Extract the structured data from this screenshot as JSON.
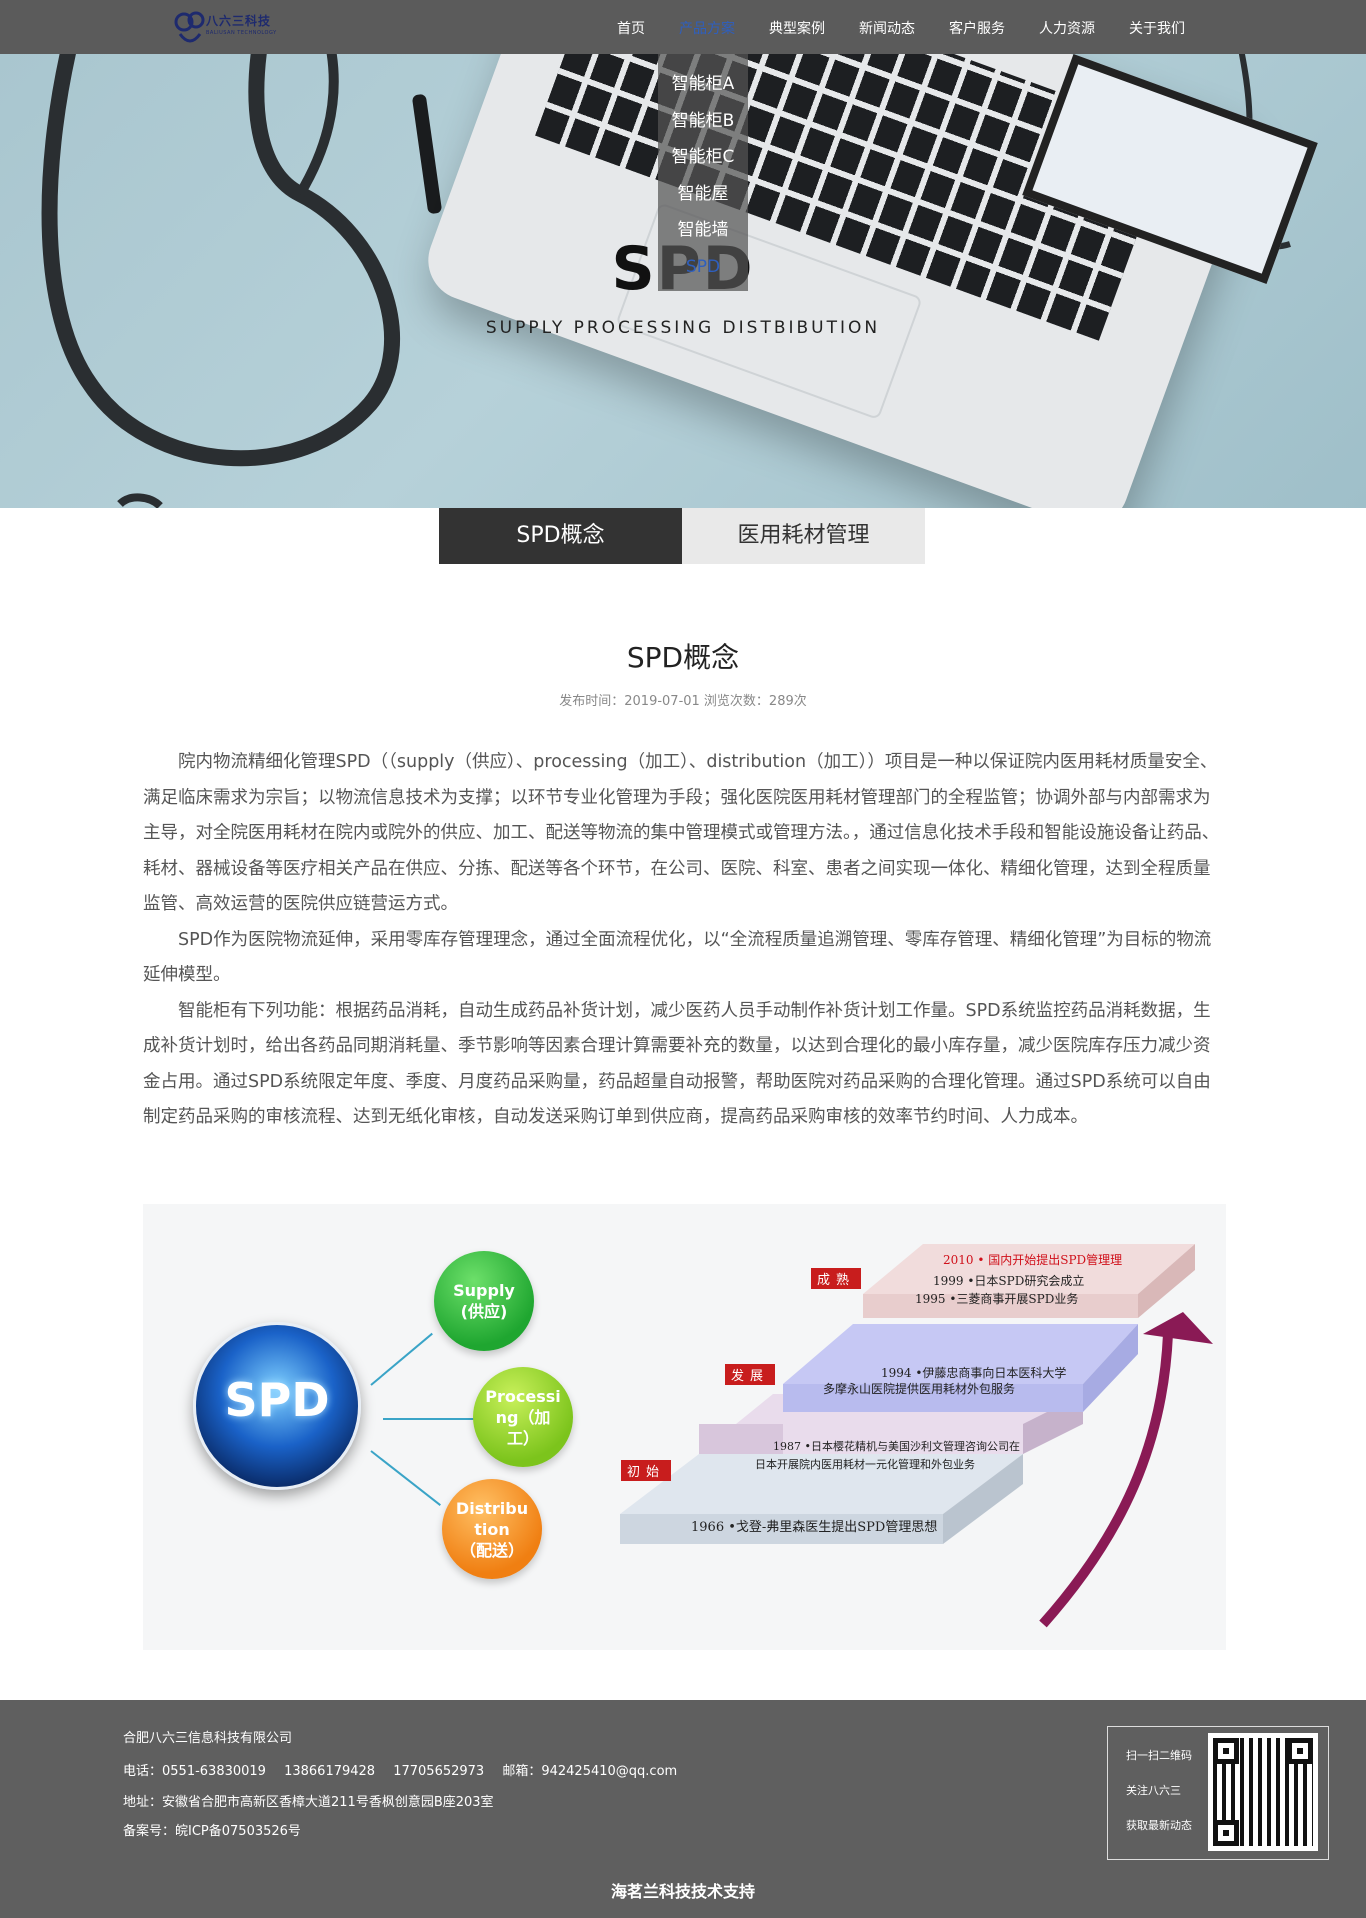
{
  "header": {
    "logo_text": "八六三科技",
    "logo_sub": "BALIUSAN TECHNOLOGY",
    "nav": [
      {
        "label": "首页",
        "active": false
      },
      {
        "label": "产品方案",
        "active": true
      },
      {
        "label": "典型案例",
        "active": false
      },
      {
        "label": "新闻动态",
        "active": false
      },
      {
        "label": "客户服务",
        "active": false
      },
      {
        "label": "人力资源",
        "active": false
      },
      {
        "label": "关于我们",
        "active": false
      }
    ],
    "dropdown": [
      {
        "label": "智能柜A",
        "active": false
      },
      {
        "label": "智能柜B",
        "active": false
      },
      {
        "label": "智能柜C",
        "active": false
      },
      {
        "label": "智能屋",
        "active": false
      },
      {
        "label": "智能墙",
        "active": false
      },
      {
        "label": "SPD",
        "active": true
      }
    ]
  },
  "hero": {
    "title": "SPD",
    "subtitle": "SUPPLY PROCESSING DISTBIBUTION"
  },
  "tabs": [
    {
      "label": "SPD概念",
      "active": true
    },
    {
      "label": "医用耗材管理",
      "active": false
    }
  ],
  "article": {
    "title": "SPD概念",
    "meta": "发布时间：2019-07-01  浏览次数：289次",
    "paragraphs": [
      "院内物流精细化管理SPD（（supply（供应）、processing（加工）、distribution（加工））项目是一种以保证院内医用耗材质量安全、满足临床需求为宗旨；以物流信息技术为支撑；以环节专业化管理为手段；强化医院医用耗材管理部门的全程监管；协调外部与内部需求为主导，对全院医用耗材在院内或院外的供应、加工、配送等物流的集中管理模式或管理方法。，通过信息化技术手段和智能设施设备让药品、耗材、器械设备等医疗相关产品在供应、分拣、配送等各个环节，在公司、医院、科室、患者之间实现一体化、精细化管理，达到全程质量监管、高效运营的医院供应链营运方式。",
      " SPD作为医院物流延伸，采用零库存管理理念，通过全面流程优化，以“全流程质量追溯管理、零库存管理、精细化管理”为目标的物流延伸模型。",
      "智能柜有下列功能：根据药品消耗，自动生成药品补货计划，减少医药人员手动制作补货计划工作量。SPD系统监控药品消耗数据，生成补货计划时，给出各药品同期消耗量、季节影响等因素合理计算需要补充的数量，以达到合理化的最小库存量，减少医院库存压力减少资金占用。通过SPD系统限定年度、季度、月度药品采购量，药品超量自动报警，帮助医院对药品采购的合理化管理。通过SPD系统可以自由制定药品采购的审核流程、达到无纸化审核，自动发送采购订单到供应商，提高药品采购审核的效率节约时间、人力成本。"
    ]
  },
  "figure": {
    "center_label": "SPD",
    "bubbles": [
      {
        "line1": "Supply",
        "line2": "(供应)"
      },
      {
        "line1": "Processi",
        "line2": "ng（加",
        "line3": "工）"
      },
      {
        "line1": "Distribu",
        "line2": "tion",
        "line3": "（配送）"
      }
    ],
    "stages": [
      {
        "label": "成熟"
      },
      {
        "label": "发展"
      },
      {
        "label": "初始"
      }
    ],
    "steps": [
      {
        "lines": [
          "2010 • 国内开始提出SPD管理理",
          "1999 •日本SPD研究会成立",
          "1995 •三菱商事开展SPD业务"
        ]
      },
      {
        "lines": [
          "1994 •伊藤忠商事向日本医科大学",
          "多摩永山医院提供医用耗材外包服务"
        ]
      },
      {
        "lines": [
          "1987 •日本樱花精机与美国沙利文管理咨询公司在",
          "日本开展院内医用耗材一元化管理和外包业务"
        ]
      },
      {
        "lines": [
          "1966 •戈登-弗里森医生提出SPD管理思想"
        ]
      }
    ],
    "highlight_color": "#d0101a"
  },
  "footer": {
    "company": "合肥八六三信息科技有限公司",
    "phone_label": "电话：0551-63830019",
    "phone2": "13866179428",
    "phone3": "17705652973",
    "email": "邮箱：942425410@qq.com",
    "address": "地址：安徽省合肥市高新区香樟大道211号香枫创意园B座203室",
    "icp": "备案号：皖ICP备07503526号",
    "qr_line1": "扫一扫二维码",
    "qr_line2": "关注八六三",
    "qr_line3": "获取最新动态",
    "support": "海茗兰科技技术支持"
  }
}
